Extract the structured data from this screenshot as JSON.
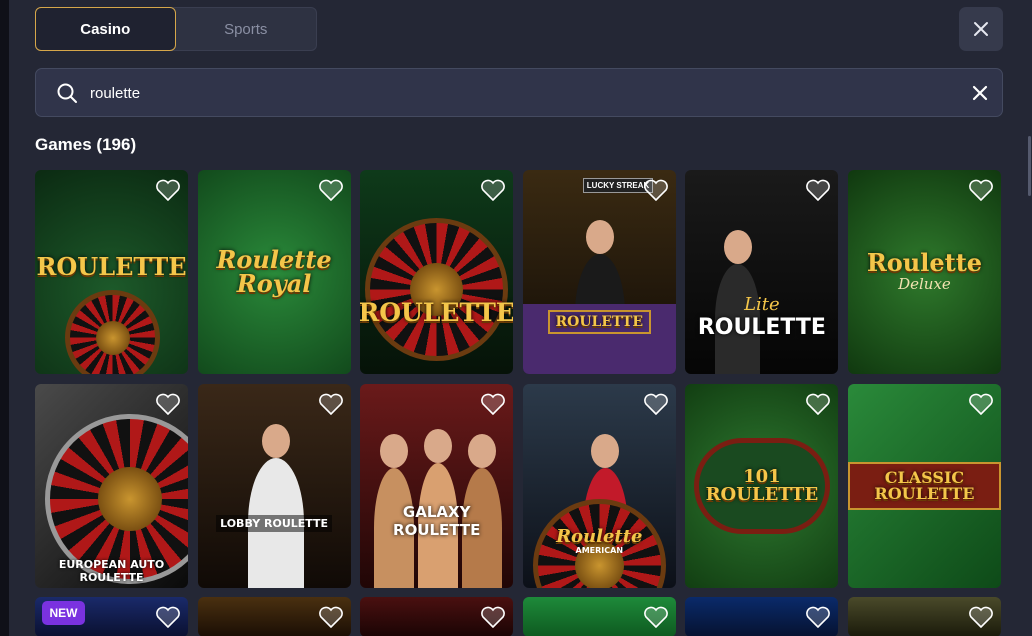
{
  "tabs": [
    {
      "label": "Casino",
      "active": true
    },
    {
      "label": "Sports",
      "active": false
    }
  ],
  "search": {
    "value": "roulette",
    "placeholder": ""
  },
  "results": {
    "title": "Games (196)"
  },
  "games_row1": [
    {
      "logo": "ROULETTE"
    },
    {
      "logo": "Roulette Royal"
    },
    {
      "logo": "ROULETTE"
    },
    {
      "logo": "ROULETTE",
      "top_badge": "LUCKY STREAK"
    },
    {
      "logo": "ROULETTE",
      "pre": "Lite"
    },
    {
      "logo": "Roulette",
      "sub": "Deluxe"
    }
  ],
  "games_row2": [
    {
      "logo": "EUROPEAN AUTO ROULETTE"
    },
    {
      "logo": "LOBBY ROULETTE"
    },
    {
      "logo": "GALAXY ROULETTE"
    },
    {
      "logo": "Roulette",
      "sub": "AMERICAN"
    },
    {
      "logo": "101 ROULETTE"
    },
    {
      "logo": "CLASSIC ROULETTE"
    }
  ],
  "games_row3": [
    {
      "badge": "NEW"
    },
    {},
    {},
    {},
    {},
    {}
  ],
  "colors": {
    "accent": "#d6a74a",
    "new_badge": "#7a32e0",
    "panel": "#242735"
  }
}
